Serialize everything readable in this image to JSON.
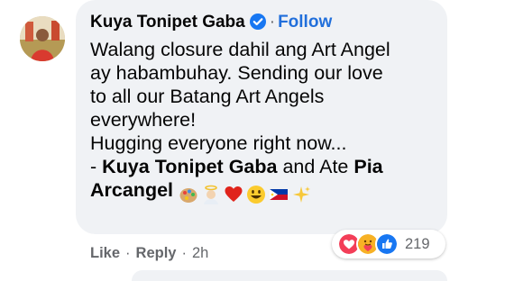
{
  "comment": {
    "author": "Kuya Tonipet Gaba",
    "follow_label": "Follow",
    "separator": "·",
    "lines": [
      "Walang closure dahil ang Art Angel",
      "ay habambuhay. Sending our love",
      "to all our Batang Art Angels",
      "everywhere!",
      "Hugging everyone right now..."
    ],
    "signoff": {
      "prefix": "- ",
      "name1": "Kuya Tonipet Gaba",
      "middle": " and Ate ",
      "name2_part1": "Pia",
      "name2_part2": "Arcangel"
    },
    "emojis": [
      "artist-palette-icon",
      "angel-icon",
      "red-heart-icon",
      "grinning-face-icon",
      "philippines-flag-icon",
      "sparkles-icon"
    ]
  },
  "actions": {
    "like_label": "Like",
    "reply_label": "Reply",
    "time": "2h",
    "separator": "·"
  },
  "reactions": {
    "icons": [
      "love-icon",
      "care-icon",
      "like-icon"
    ],
    "count": "219"
  },
  "colors": {
    "bubble": "#f0f2f5",
    "follow": "#216fdb",
    "verified": "#1877f2",
    "meta": "#65676b"
  }
}
